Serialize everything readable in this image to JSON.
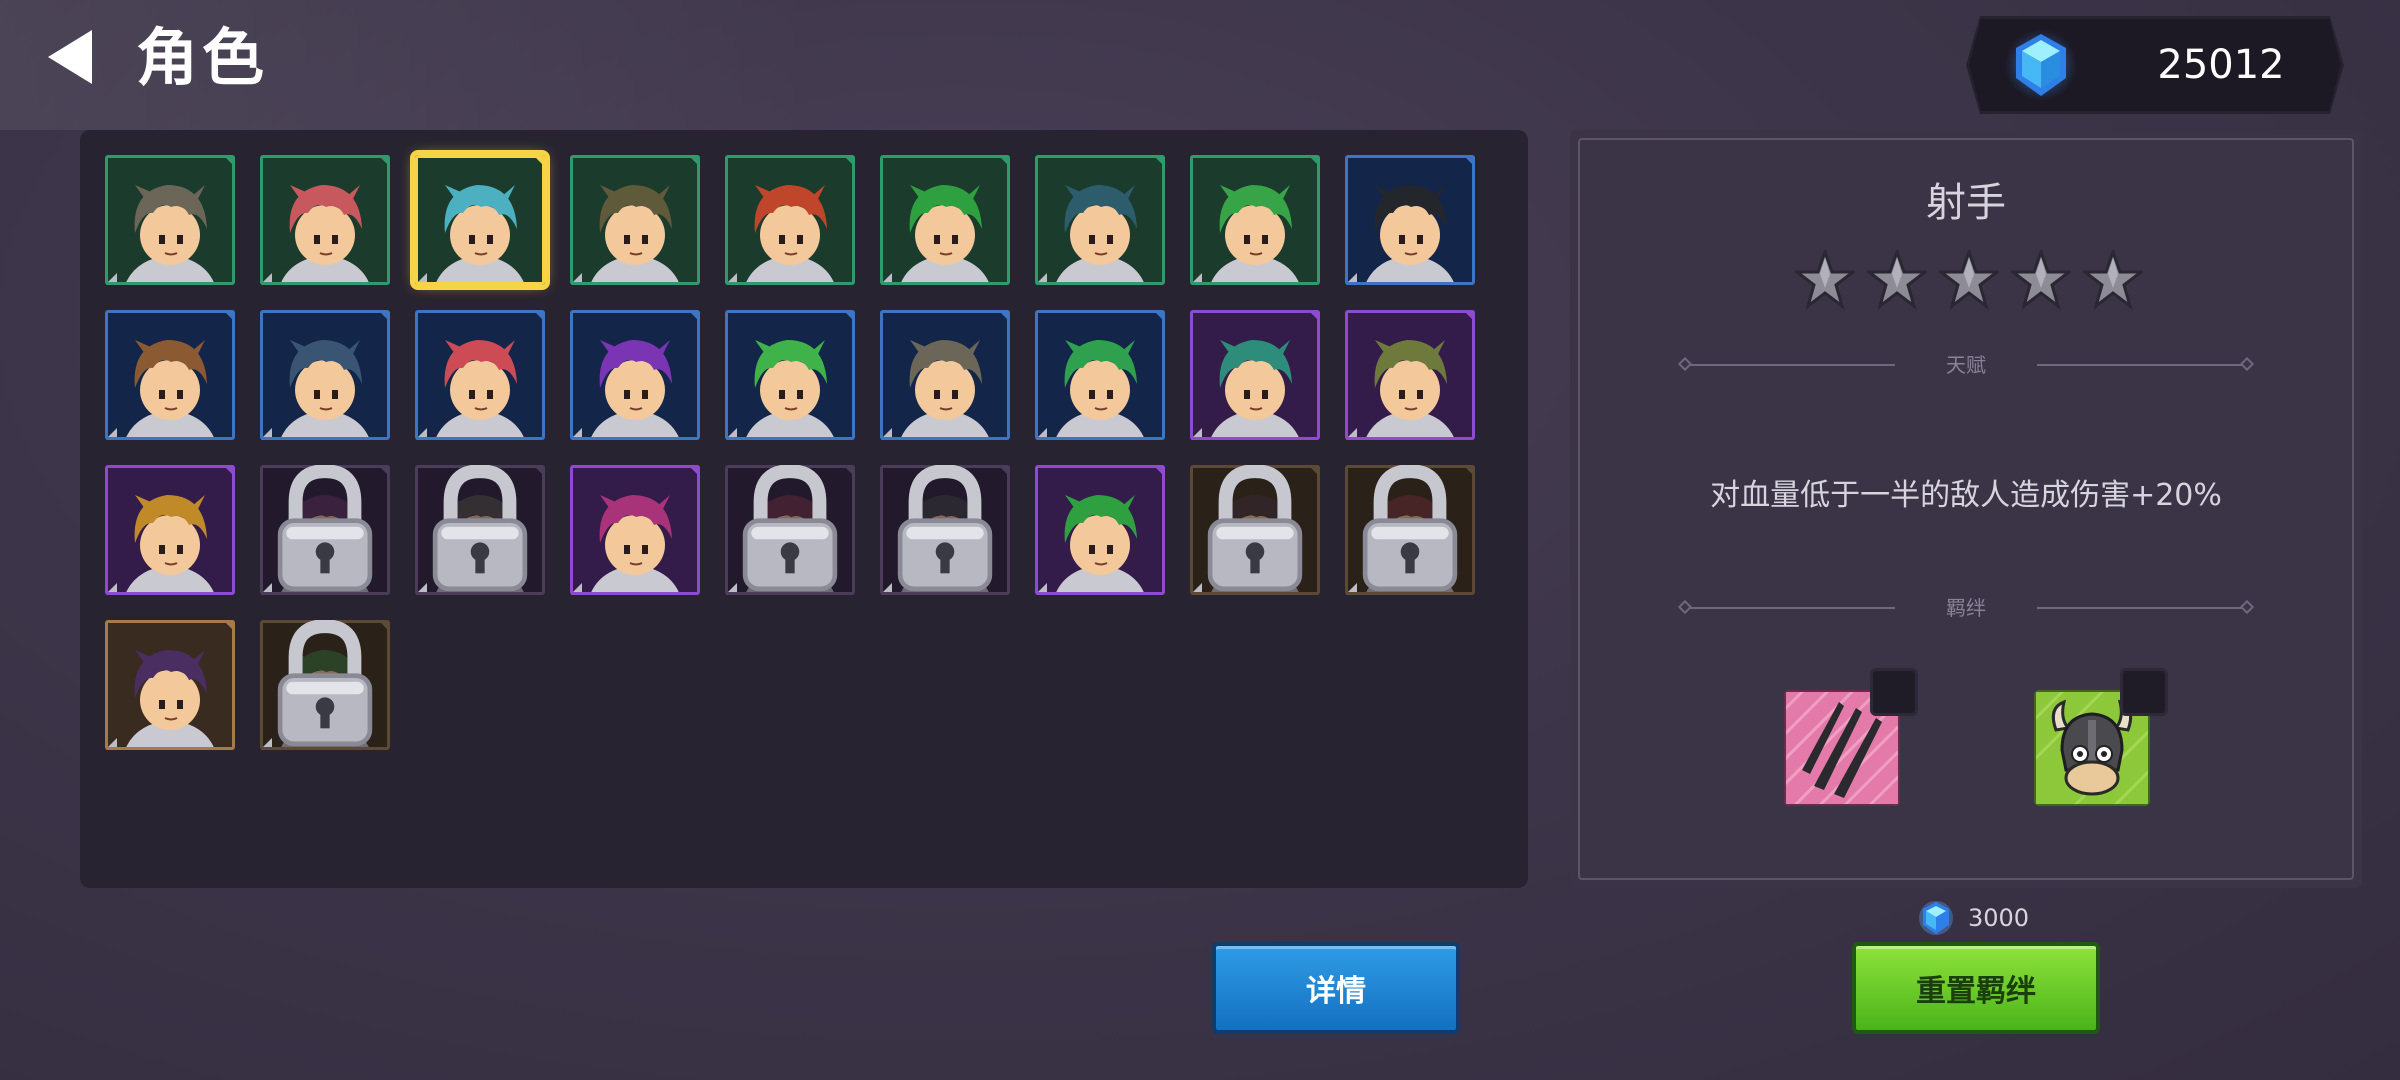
{
  "header": {
    "title": "角色",
    "back_icon": "back-arrow-icon",
    "currency": {
      "icon": "gem-icon",
      "amount": "25012"
    }
  },
  "roster": {
    "cards": [
      {
        "hair": "#6b6658",
        "bg": "#1b3b2c",
        "border": "#2f9b6c",
        "locked": false
      },
      {
        "hair": "#c7595e",
        "bg": "#1b3b2c",
        "border": "#2f9b6c",
        "locked": false
      },
      {
        "hair": "#4cb0c1",
        "bg": "#1b3b2c",
        "border": "#f7d445",
        "locked": false,
        "selected": true
      },
      {
        "hair": "#5f5a3a",
        "bg": "#1b3b2c",
        "border": "#2f9b6c",
        "locked": false
      },
      {
        "hair": "#c0462b",
        "bg": "#1b3b2c",
        "border": "#2f9b6c",
        "locked": false
      },
      {
        "hair": "#2fa03f",
        "bg": "#1b3b2c",
        "border": "#2f9b6c",
        "locked": false
      },
      {
        "hair": "#2d5d6d",
        "bg": "#1b3b2c",
        "border": "#2f9b6c",
        "locked": false
      },
      {
        "hair": "#37a547",
        "bg": "#1b3b2c",
        "border": "#2f9b6c",
        "locked": false
      },
      {
        "hair": "#23272c",
        "bg": "#13264a",
        "border": "#3d74c4",
        "locked": false
      },
      {
        "hair": "#8b5a32",
        "bg": "#13264a",
        "border": "#3d74c4",
        "locked": false
      },
      {
        "hair": "#3a5573",
        "bg": "#13264a",
        "border": "#3d74c4",
        "locked": false
      },
      {
        "hair": "#cc4b55",
        "bg": "#13264a",
        "border": "#3d74c4",
        "locked": false
      },
      {
        "hair": "#7b34b4",
        "bg": "#13264a",
        "border": "#3d74c4",
        "locked": false
      },
      {
        "hair": "#3fb24a",
        "bg": "#13264a",
        "border": "#3d74c4",
        "locked": false
      },
      {
        "hair": "#6b6658",
        "bg": "#13264a",
        "border": "#3d74c4",
        "locked": false
      },
      {
        "hair": "#2ea04e",
        "bg": "#13264a",
        "border": "#3d74c4",
        "locked": false
      },
      {
        "hair": "#2e8c7b",
        "bg": "#331c4a",
        "border": "#8e4bd2",
        "locked": false
      },
      {
        "hair": "#6d7a3c",
        "bg": "#331c4a",
        "border": "#8e4bd2",
        "locked": false
      },
      {
        "hair": "#c08a28",
        "bg": "#331c4a",
        "border": "#8e4bd2",
        "locked": false
      },
      {
        "hair": "#5a2a55",
        "bg": "#221a2c",
        "border": "#4b3d5a",
        "locked": true
      },
      {
        "hair": "#4a4a3a",
        "bg": "#221a2c",
        "border": "#4b3d5a",
        "locked": true
      },
      {
        "hair": "#a83378",
        "bg": "#331c4a",
        "border": "#8e4bd2",
        "locked": false
      },
      {
        "hair": "#6b2a3a",
        "bg": "#221a2c",
        "border": "#4b3d5a",
        "locked": true
      },
      {
        "hair": "#3a3a3a",
        "bg": "#221a2c",
        "border": "#4b3d5a",
        "locked": true
      },
      {
        "hair": "#2fa03f",
        "bg": "#331c4a",
        "border": "#8e4bd2",
        "locked": false
      },
      {
        "hair": "#3a2c3a",
        "bg": "#2a2218",
        "border": "#5c4a34",
        "locked": true
      },
      {
        "hair": "#6b2a3a",
        "bg": "#2a2218",
        "border": "#5c4a34",
        "locked": true
      },
      {
        "hair": "#4a2e62",
        "bg": "#3a2b20",
        "border": "#a87a4a",
        "locked": false
      },
      {
        "hair": "#2f6a3a",
        "bg": "#2a2218",
        "border": "#5c4a34",
        "locked": true
      }
    ]
  },
  "detail": {
    "name": "射手",
    "stars": 5,
    "talent_label": "天赋",
    "talent_text": "对血量低于一半的敌人造成伤害+20%",
    "bond_label": "羁绊",
    "bonds": [
      {
        "icon": "claw-slash-icon"
      },
      {
        "icon": "viking-helmet-icon"
      }
    ]
  },
  "footer": {
    "cost": "3000",
    "cost_icon": "gem-icon",
    "details_button": "详情",
    "reset_button": "重置羁绊"
  },
  "colors": {
    "selected_outline": "#f7d445",
    "details_button": "#1e86d6",
    "reset_button": "#6bcb2a"
  }
}
